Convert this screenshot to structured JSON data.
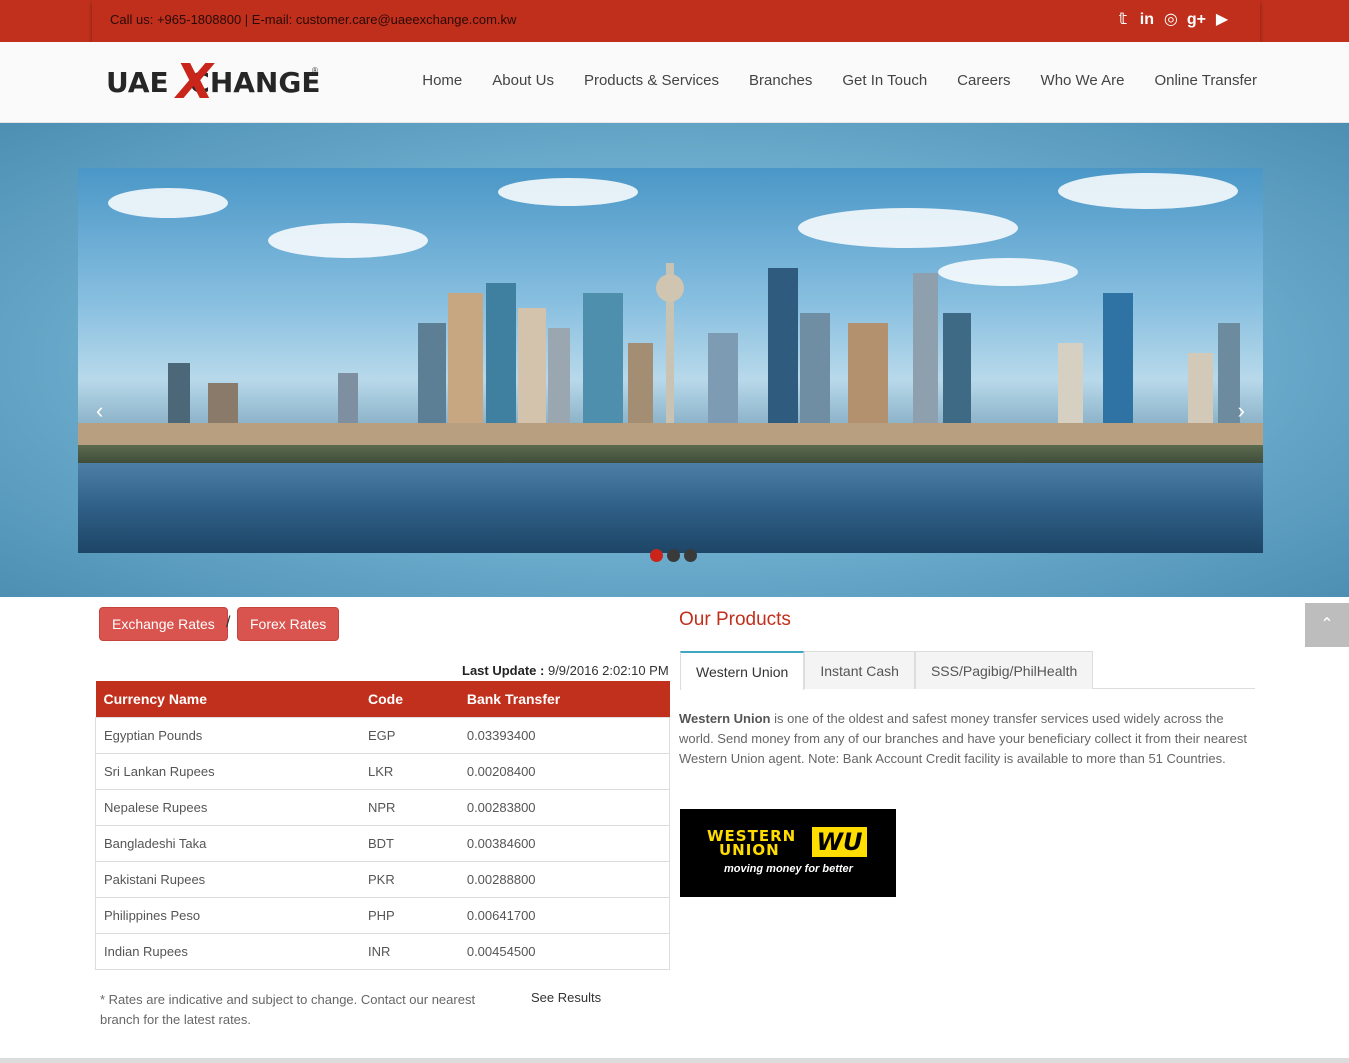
{
  "topbar": {
    "contact": "Call us: +965-1808800 | E-mail: customer.care@uaeexchange.com.kw",
    "social_icons": [
      "twitter-icon",
      "linkedin-icon",
      "instagram-icon",
      "google-plus-icon",
      "youtube-icon"
    ],
    "social_glyphs": [
      "𝕥",
      "in",
      "◎",
      "g+",
      "▶"
    ]
  },
  "logo": {
    "left": "UAE",
    "x": "X",
    "right": "CHANGE",
    "reg": "®"
  },
  "nav": [
    "Home",
    "About Us",
    "Products & Services",
    "Branches",
    "Get In Touch",
    "Careers",
    "Who We Are",
    "Online Transfer"
  ],
  "slider": {
    "prev": "‹",
    "next": "›",
    "slides": 3,
    "active": 0
  },
  "rates": {
    "tab_exchange": "Exchange Rates",
    "separator": "/",
    "tab_forex": "Forex Rates",
    "last_update_label": "Last Update :",
    "last_update_value": "9/9/2016 2:02:10 PM",
    "headers": [
      "Currency Name",
      "Code",
      "Bank Transfer"
    ],
    "rows": [
      [
        "Egyptian Pounds",
        "EGP",
        "0.03393400"
      ],
      [
        "Sri Lankan Rupees",
        "LKR",
        "0.00208400"
      ],
      [
        "Nepalese Rupees",
        "NPR",
        "0.00283800"
      ],
      [
        "Bangladeshi Taka",
        "BDT",
        "0.00384600"
      ],
      [
        "Pakistani Rupees",
        "PKR",
        "0.00288800"
      ],
      [
        "Philippines Peso",
        "PHP",
        "0.00641700"
      ],
      [
        "Indian Rupees",
        "INR",
        "0.00454500"
      ]
    ],
    "note": "* Rates are indicative and subject to change. Contact our nearest branch for the latest rates.",
    "see_results": "See Results"
  },
  "products": {
    "title": "Our Products",
    "tabs": [
      "Western Union",
      "Instant Cash",
      "SSS/Pagibig/PhilHealth"
    ],
    "active_tab": 0,
    "desc_bold": "Western Union",
    "desc_rest": " is one of the oldest and safest money transfer services used widely across the world. Send money from any of our branches and have your beneficiary collect it from their nearest Western Union agent. Note: Bank Account Credit facility is available to more than 51 Countries.",
    "logo_line1": "WESTERN",
    "logo_line2": "UNION",
    "logo_mark": "WU",
    "logo_tagline": "moving money for better"
  },
  "scroll_top": "⌃",
  "colors": {
    "brand_red": "#c1301c",
    "button_red": "#d9534f",
    "tab_accent": "#3fa7c2"
  }
}
